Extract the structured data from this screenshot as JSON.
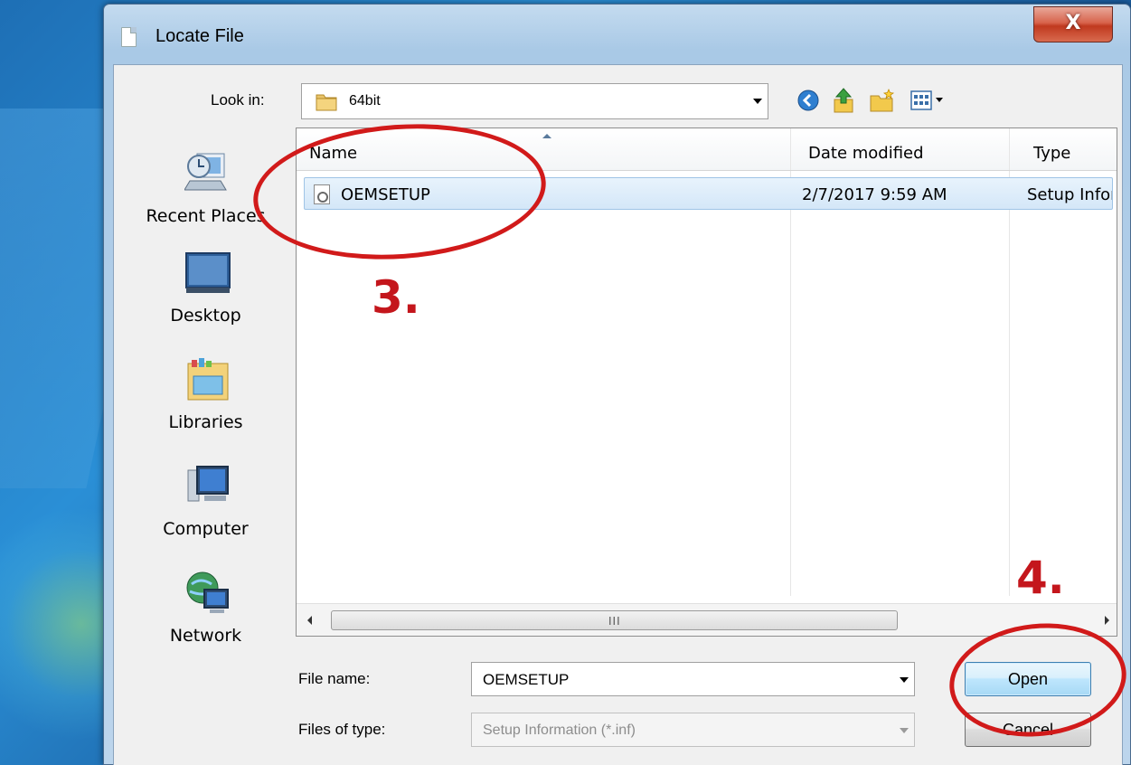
{
  "window": {
    "title": "Locate File",
    "close_label": "X"
  },
  "toolbar": {
    "look_in_label": "Look in:",
    "look_in_value": "64bit",
    "icons": [
      "back-icon",
      "up-folder-icon",
      "new-folder-icon",
      "view-menu-icon"
    ]
  },
  "places": [
    {
      "label": "Recent Places",
      "icon": "recent-places-icon"
    },
    {
      "label": "Desktop",
      "icon": "desktop-icon"
    },
    {
      "label": "Libraries",
      "icon": "libraries-icon"
    },
    {
      "label": "Computer",
      "icon": "computer-icon"
    },
    {
      "label": "Network",
      "icon": "network-icon"
    }
  ],
  "file_list": {
    "columns": [
      "Name",
      "Date modified",
      "Type"
    ],
    "rows": [
      {
        "name": "OEMSETUP",
        "date_modified": "2/7/2017 9:59 AM",
        "type": "Setup Information"
      }
    ],
    "scroll_grip": "III"
  },
  "form": {
    "file_name_label": "File name:",
    "file_name_value": "OEMSETUP",
    "files_of_type_label": "Files of type:",
    "files_of_type_value": "Setup Information (*.inf)"
  },
  "buttons": {
    "open": "Open",
    "cancel": "Cancel"
  },
  "annotations": {
    "step_3": "3.",
    "step_4": "4.",
    "color": "#d11a1a"
  }
}
